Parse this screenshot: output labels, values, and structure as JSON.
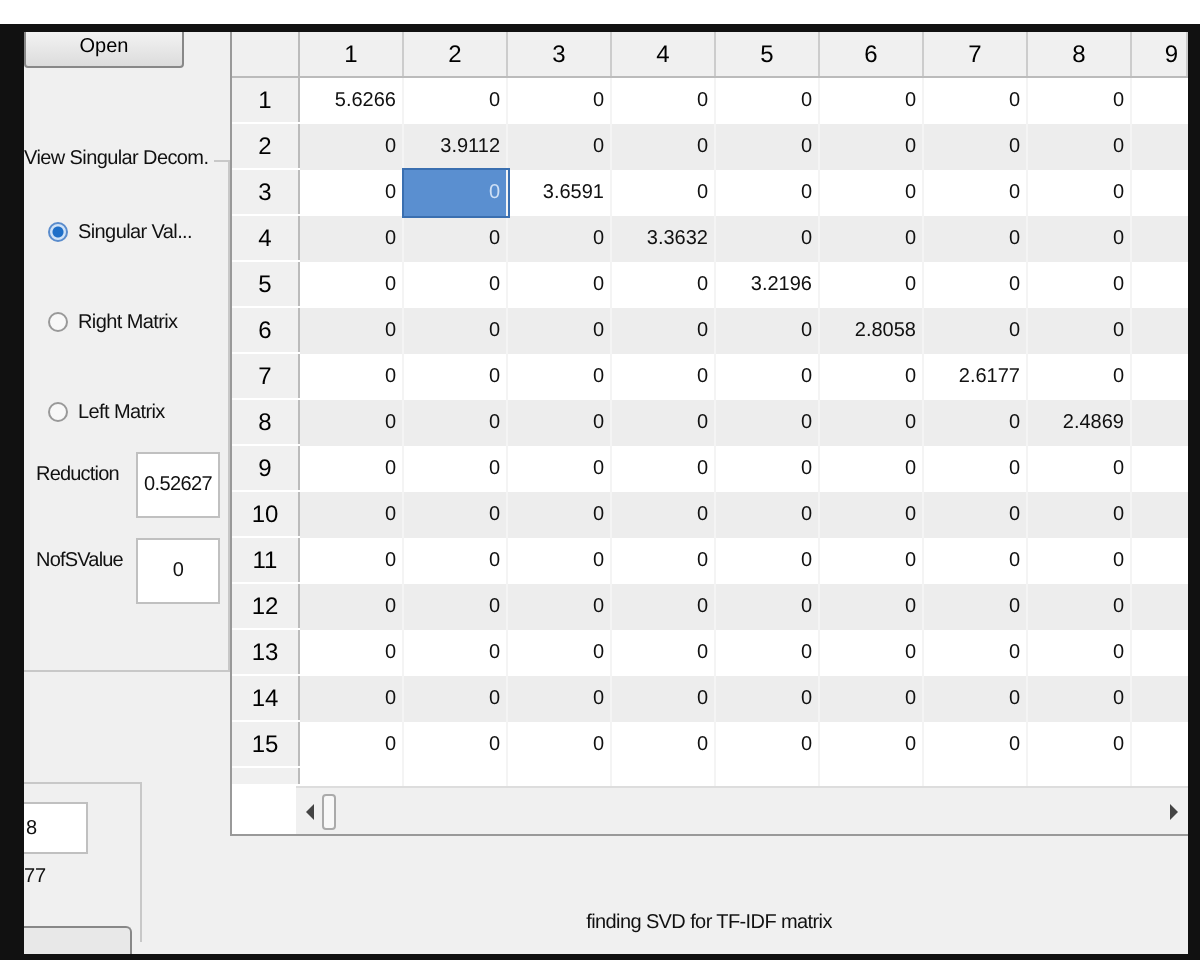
{
  "left_panel": {
    "open_button": "Open",
    "group": {
      "title": "View Singular Decom.",
      "options": [
        {
          "label": "Singular Val...",
          "selected": true
        },
        {
          "label": "Right Matrix",
          "selected": false
        },
        {
          "label": "Left Matrix",
          "selected": false
        }
      ],
      "reduction": {
        "label": "Reduction",
        "value": "0.52627"
      },
      "nofsvalue": {
        "label": "NofSValue",
        "value": "0"
      }
    },
    "lower_group": {
      "field_value": "8",
      "text": "77"
    }
  },
  "table": {
    "columns": [
      "1",
      "2",
      "3",
      "4",
      "5",
      "6",
      "7",
      "8",
      "9"
    ],
    "rows": [
      {
        "header": "1",
        "cells": [
          {
            "text": "5.6266",
            "selected": false
          },
          {
            "text": "0",
            "selected": false
          },
          {
            "text": "0",
            "selected": false
          },
          {
            "text": "0",
            "selected": false
          },
          {
            "text": "0",
            "selected": false
          },
          {
            "text": "0",
            "selected": false
          },
          {
            "text": "0",
            "selected": false
          },
          {
            "text": "0",
            "selected": false
          }
        ]
      },
      {
        "header": "2",
        "cells": [
          {
            "text": "0",
            "selected": false
          },
          {
            "text": "3.9112",
            "selected": false
          },
          {
            "text": "0",
            "selected": false
          },
          {
            "text": "0",
            "selected": false
          },
          {
            "text": "0",
            "selected": false
          },
          {
            "text": "0",
            "selected": false
          },
          {
            "text": "0",
            "selected": false
          },
          {
            "text": "0",
            "selected": false
          }
        ]
      },
      {
        "header": "3",
        "cells": [
          {
            "text": "0",
            "selected": false
          },
          {
            "text": "0",
            "selected": true
          },
          {
            "text": "3.6591",
            "selected": false
          },
          {
            "text": "0",
            "selected": false
          },
          {
            "text": "0",
            "selected": false
          },
          {
            "text": "0",
            "selected": false
          },
          {
            "text": "0",
            "selected": false
          },
          {
            "text": "0",
            "selected": false
          }
        ]
      },
      {
        "header": "4",
        "cells": [
          {
            "text": "0",
            "selected": false
          },
          {
            "text": "0",
            "selected": false
          },
          {
            "text": "0",
            "selected": false
          },
          {
            "text": "3.3632",
            "selected": false
          },
          {
            "text": "0",
            "selected": false
          },
          {
            "text": "0",
            "selected": false
          },
          {
            "text": "0",
            "selected": false
          },
          {
            "text": "0",
            "selected": false
          }
        ]
      },
      {
        "header": "5",
        "cells": [
          {
            "text": "0",
            "selected": false
          },
          {
            "text": "0",
            "selected": false
          },
          {
            "text": "0",
            "selected": false
          },
          {
            "text": "0",
            "selected": false
          },
          {
            "text": "3.2196",
            "selected": false
          },
          {
            "text": "0",
            "selected": false
          },
          {
            "text": "0",
            "selected": false
          },
          {
            "text": "0",
            "selected": false
          }
        ]
      },
      {
        "header": "6",
        "cells": [
          {
            "text": "0",
            "selected": false
          },
          {
            "text": "0",
            "selected": false
          },
          {
            "text": "0",
            "selected": false
          },
          {
            "text": "0",
            "selected": false
          },
          {
            "text": "0",
            "selected": false
          },
          {
            "text": "2.8058",
            "selected": false
          },
          {
            "text": "0",
            "selected": false
          },
          {
            "text": "0",
            "selected": false
          }
        ]
      },
      {
        "header": "7",
        "cells": [
          {
            "text": "0",
            "selected": false
          },
          {
            "text": "0",
            "selected": false
          },
          {
            "text": "0",
            "selected": false
          },
          {
            "text": "0",
            "selected": false
          },
          {
            "text": "0",
            "selected": false
          },
          {
            "text": "0",
            "selected": false
          },
          {
            "text": "2.6177",
            "selected": false
          },
          {
            "text": "0",
            "selected": false
          }
        ]
      },
      {
        "header": "8",
        "cells": [
          {
            "text": "0",
            "selected": false
          },
          {
            "text": "0",
            "selected": false
          },
          {
            "text": "0",
            "selected": false
          },
          {
            "text": "0",
            "selected": false
          },
          {
            "text": "0",
            "selected": false
          },
          {
            "text": "0",
            "selected": false
          },
          {
            "text": "0",
            "selected": false
          },
          {
            "text": "2.4869",
            "selected": false
          }
        ]
      },
      {
        "header": "9",
        "cells": [
          {
            "text": "0",
            "selected": false
          },
          {
            "text": "0",
            "selected": false
          },
          {
            "text": "0",
            "selected": false
          },
          {
            "text": "0",
            "selected": false
          },
          {
            "text": "0",
            "selected": false
          },
          {
            "text": "0",
            "selected": false
          },
          {
            "text": "0",
            "selected": false
          },
          {
            "text": "0",
            "selected": false
          }
        ]
      },
      {
        "header": "10",
        "cells": [
          {
            "text": "0",
            "selected": false
          },
          {
            "text": "0",
            "selected": false
          },
          {
            "text": "0",
            "selected": false
          },
          {
            "text": "0",
            "selected": false
          },
          {
            "text": "0",
            "selected": false
          },
          {
            "text": "0",
            "selected": false
          },
          {
            "text": "0",
            "selected": false
          },
          {
            "text": "0",
            "selected": false
          }
        ]
      },
      {
        "header": "11",
        "cells": [
          {
            "text": "0",
            "selected": false
          },
          {
            "text": "0",
            "selected": false
          },
          {
            "text": "0",
            "selected": false
          },
          {
            "text": "0",
            "selected": false
          },
          {
            "text": "0",
            "selected": false
          },
          {
            "text": "0",
            "selected": false
          },
          {
            "text": "0",
            "selected": false
          },
          {
            "text": "0",
            "selected": false
          }
        ]
      },
      {
        "header": "12",
        "cells": [
          {
            "text": "0",
            "selected": false
          },
          {
            "text": "0",
            "selected": false
          },
          {
            "text": "0",
            "selected": false
          },
          {
            "text": "0",
            "selected": false
          },
          {
            "text": "0",
            "selected": false
          },
          {
            "text": "0",
            "selected": false
          },
          {
            "text": "0",
            "selected": false
          },
          {
            "text": "0",
            "selected": false
          }
        ]
      },
      {
        "header": "13",
        "cells": [
          {
            "text": "0",
            "selected": false
          },
          {
            "text": "0",
            "selected": false
          },
          {
            "text": "0",
            "selected": false
          },
          {
            "text": "0",
            "selected": false
          },
          {
            "text": "0",
            "selected": false
          },
          {
            "text": "0",
            "selected": false
          },
          {
            "text": "0",
            "selected": false
          },
          {
            "text": "0",
            "selected": false
          }
        ]
      },
      {
        "header": "14",
        "cells": [
          {
            "text": "0",
            "selected": false
          },
          {
            "text": "0",
            "selected": false
          },
          {
            "text": "0",
            "selected": false
          },
          {
            "text": "0",
            "selected": false
          },
          {
            "text": "0",
            "selected": false
          },
          {
            "text": "0",
            "selected": false
          },
          {
            "text": "0",
            "selected": false
          },
          {
            "text": "0",
            "selected": false
          }
        ]
      },
      {
        "header": "15",
        "cells": [
          {
            "text": "0",
            "selected": false
          },
          {
            "text": "0",
            "selected": false
          },
          {
            "text": "0",
            "selected": false
          },
          {
            "text": "0",
            "selected": false
          },
          {
            "text": "0",
            "selected": false
          },
          {
            "text": "0",
            "selected": false
          },
          {
            "text": "0",
            "selected": false
          },
          {
            "text": "0",
            "selected": false
          }
        ]
      }
    ]
  },
  "status": "finding SVD for TF-IDF matrix"
}
